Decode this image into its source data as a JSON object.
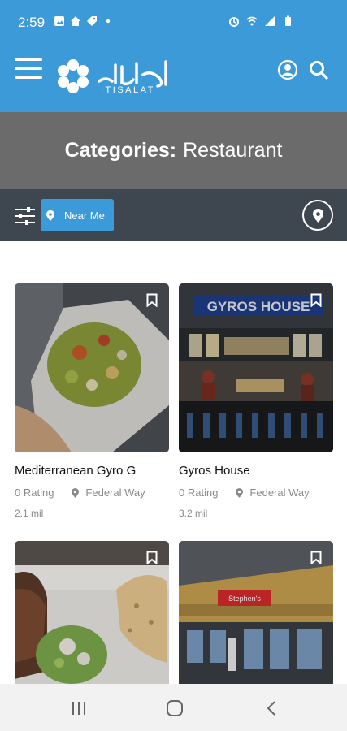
{
  "status_bar": {
    "time": "2:59"
  },
  "header": {
    "logo_arabic": "اتصالات",
    "logo_latin": "ITISALAT"
  },
  "category": {
    "prefix": "Categories:",
    "name": "Restaurant"
  },
  "filter": {
    "near_me_label": "Near Me"
  },
  "listings": [
    {
      "title": "Mediterranean Gyro G",
      "rating": "0 Rating",
      "location": "Federal Way",
      "distance": "2.1 mil"
    },
    {
      "title": "Gyros House",
      "rating": "0 Rating",
      "location": "Federal Way",
      "distance": "3.2 mil",
      "sign_text": "GYROS HOUSE"
    },
    {
      "title": "",
      "rating": "",
      "location": "",
      "distance": ""
    },
    {
      "title": "",
      "rating": "",
      "location": "",
      "distance": "",
      "sign_text": "Stephen's"
    }
  ],
  "colors": {
    "brand_blue": "#3d9ad8",
    "banner_gray": "#6b6b6b",
    "filter_bar": "#3e4650"
  }
}
